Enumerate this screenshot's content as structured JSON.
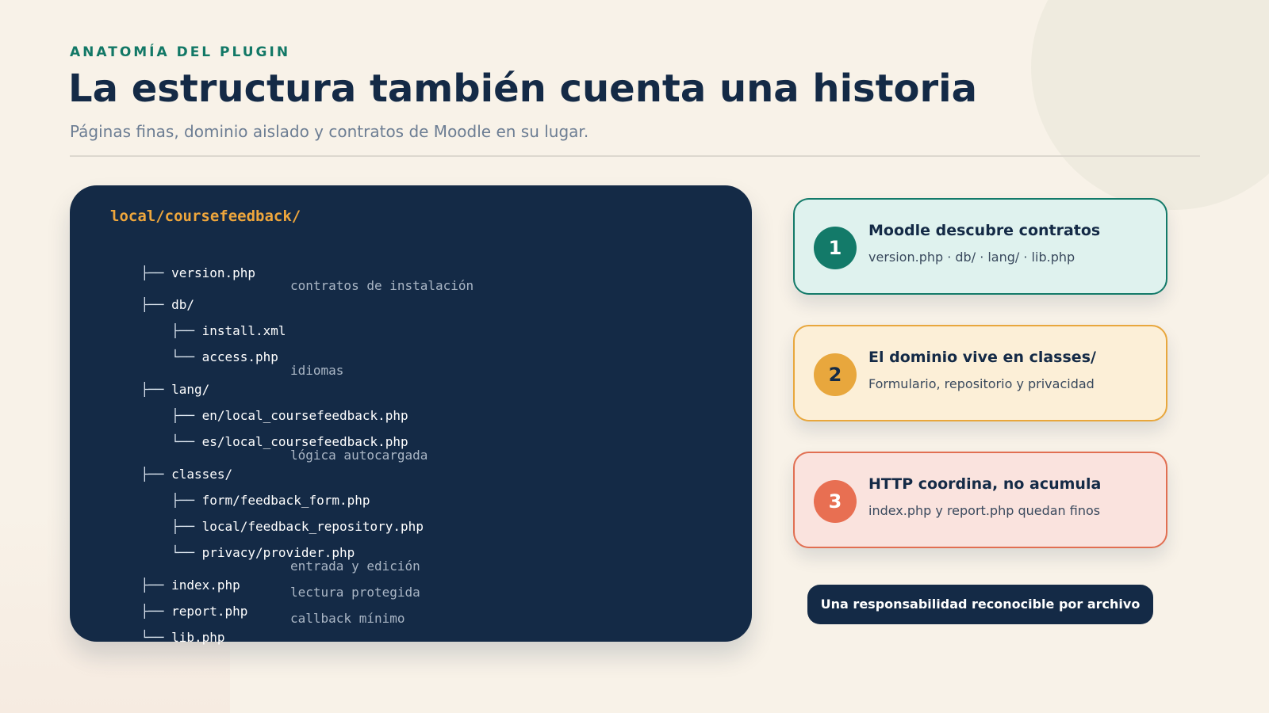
{
  "header": {
    "eyebrow": "ANATOMÍA DEL PLUGIN",
    "title": "La estructura también cuenta una historia",
    "subtitle": "Páginas finas, dominio aislado y contratos de Moodle en su lugar."
  },
  "tree": {
    "root": "local/coursefeedback/",
    "rows": [
      {
        "branch": "├── ",
        "name": "version.php",
        "note": ""
      },
      {
        "branch": "├── ",
        "name": "db/",
        "note": "contratos de instalación"
      },
      {
        "branch": "    ├── ",
        "name": "install.xml",
        "note": ""
      },
      {
        "branch": "    └── ",
        "name": "access.php",
        "note": ""
      },
      {
        "branch": "├── ",
        "name": "lang/",
        "note": "idiomas"
      },
      {
        "branch": "    ├── ",
        "name": "en/local_coursefeedback.php",
        "note": ""
      },
      {
        "branch": "    └── ",
        "name": "es/local_coursefeedback.php",
        "note": ""
      },
      {
        "branch": "├── ",
        "name": "classes/",
        "note": "lógica autocargada"
      },
      {
        "branch": "    ├── ",
        "name": "form/feedback_form.php",
        "note": ""
      },
      {
        "branch": "    ├── ",
        "name": "local/feedback_repository.php",
        "note": ""
      },
      {
        "branch": "    └── ",
        "name": "privacy/provider.php",
        "note": ""
      },
      {
        "branch": "├── ",
        "name": "index.php",
        "note": "entrada y edición"
      },
      {
        "branch": "├── ",
        "name": "report.php",
        "note": "lectura protegida"
      },
      {
        "branch": "└── ",
        "name": "lib.php",
        "note": "callback mínimo"
      }
    ]
  },
  "cards": [
    {
      "number": "1",
      "title": "Moodle descubre contratos",
      "description": "version.php · db/ · lang/ · lib.php"
    },
    {
      "number": "2",
      "title": "El dominio vive en classes/",
      "description": "Formulario, repositorio y privacidad"
    },
    {
      "number": "3",
      "title": "HTTP coordina, no acumula",
      "description": "index.php y report.php quedan finos"
    }
  ],
  "footer": {
    "label": "Una responsabilidad reconocible por archivo"
  },
  "colors": {
    "navy": "#142a46",
    "teal": "#137a69",
    "amber": "#e8a73d",
    "coral": "#e86f52",
    "background": "#f8f2e8"
  }
}
